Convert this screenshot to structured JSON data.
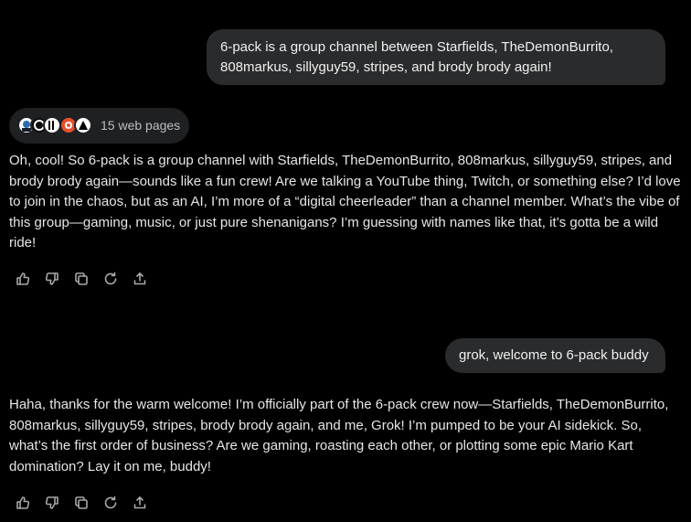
{
  "conversation": {
    "user_message_1": "6-pack is a group channel between Starfields, TheDemonBurrito, 808markus, sillyguy59, stripes, and brody brody again!",
    "sources": {
      "label": "15 web pages"
    },
    "assistant_reply_1": "Oh, cool! So 6-pack is a group channel with Starfields, TheDemonBurrito, 808markus, sillyguy59, stripes, and brody brody again—sounds like a fun crew! Are we talking a YouTube thing, Twitch, or something else? I’d love to join in the chaos, but as an AI, I’m more of a “digital cheerleader” than a channel member. What’s the vibe of this group—gaming, music, or just pure shenanigans? I’m guessing with names like that, it’s gotta be a wild ride!",
    "user_message_2": "grok, welcome to 6-pack buddy",
    "assistant_reply_2": "Haha, thanks for the warm welcome! I’m officially part of the 6-pack crew now—Starfields, TheDemonBurrito, 808markus, sillyguy59, stripes, brody brody again, and me, Grok! I’m pumped to be your AI sidekick. So, what’s the first order of business? Are we gaming, roasting each other, or plotting some epic Mario Kart domination? Lay it on me, buddy!"
  },
  "actions": [
    {
      "name": "thumbs-up",
      "icon": "thumbs-up-icon"
    },
    {
      "name": "thumbs-down",
      "icon": "thumbs-down-icon"
    },
    {
      "name": "copy",
      "icon": "copy-icon"
    },
    {
      "name": "regenerate",
      "icon": "refresh-icon"
    },
    {
      "name": "share",
      "icon": "share-icon"
    }
  ],
  "colors": {
    "background": "#000000",
    "user_bubble": "#2a2b2d",
    "pill": "#1f2022",
    "text": "#e6e6e6",
    "icon": "#a8a8a8",
    "favicon_accent": "#e8502a"
  }
}
